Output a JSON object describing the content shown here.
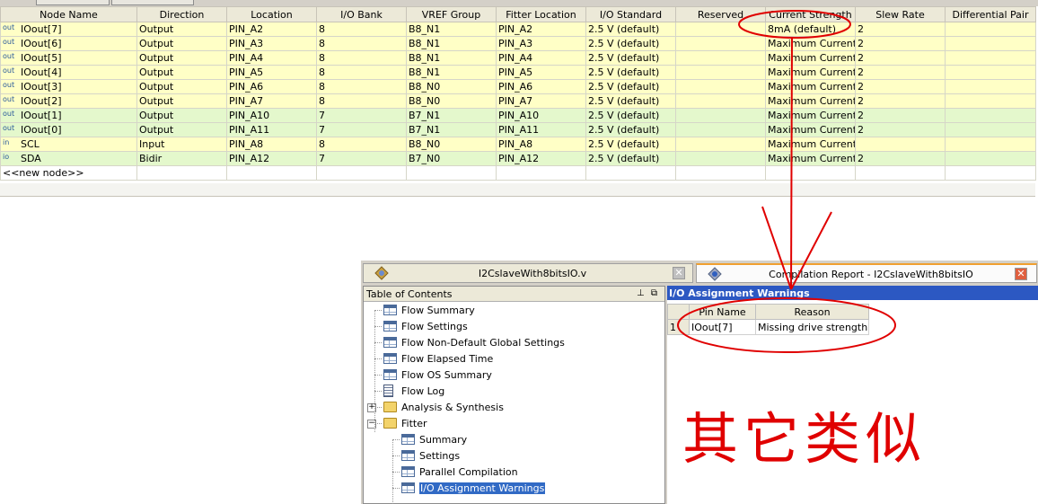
{
  "pin_table": {
    "columns": [
      "Node Name",
      "Direction",
      "Location",
      "I/O Bank",
      "VREF Group",
      "Fitter Location",
      "I/O Standard",
      "Reserved",
      "Current Strength",
      "Slew Rate",
      "Differential Pair"
    ],
    "rows": [
      {
        "icon": "out",
        "name": "IOout[7]",
        "direction": "Output",
        "location": "PIN_A2",
        "bank": "8",
        "vref": "B8_N1",
        "fitter": "PIN_A2",
        "standard": "2.5 V (default)",
        "reserved": "",
        "strength": "8mA (default)",
        "slew": "2",
        "diff": ""
      },
      {
        "icon": "out",
        "name": "IOout[6]",
        "direction": "Output",
        "location": "PIN_A3",
        "bank": "8",
        "vref": "B8_N1",
        "fitter": "PIN_A3",
        "standard": "2.5 V (default)",
        "reserved": "",
        "strength": "Maximum Current",
        "slew": "2",
        "diff": ""
      },
      {
        "icon": "out",
        "name": "IOout[5]",
        "direction": "Output",
        "location": "PIN_A4",
        "bank": "8",
        "vref": "B8_N1",
        "fitter": "PIN_A4",
        "standard": "2.5 V (default)",
        "reserved": "",
        "strength": "Maximum Current",
        "slew": "2",
        "diff": ""
      },
      {
        "icon": "out",
        "name": "IOout[4]",
        "direction": "Output",
        "location": "PIN_A5",
        "bank": "8",
        "vref": "B8_N1",
        "fitter": "PIN_A5",
        "standard": "2.5 V (default)",
        "reserved": "",
        "strength": "Maximum Current",
        "slew": "2",
        "diff": ""
      },
      {
        "icon": "out",
        "name": "IOout[3]",
        "direction": "Output",
        "location": "PIN_A6",
        "bank": "8",
        "vref": "B8_N0",
        "fitter": "PIN_A6",
        "standard": "2.5 V (default)",
        "reserved": "",
        "strength": "Maximum Current",
        "slew": "2",
        "diff": ""
      },
      {
        "icon": "out",
        "name": "IOout[2]",
        "direction": "Output",
        "location": "PIN_A7",
        "bank": "8",
        "vref": "B8_N0",
        "fitter": "PIN_A7",
        "standard": "2.5 V (default)",
        "reserved": "",
        "strength": "Maximum Current",
        "slew": "2",
        "diff": ""
      },
      {
        "icon": "out",
        "name": "IOout[1]",
        "direction": "Output",
        "location": "PIN_A10",
        "bank": "7",
        "vref": "B7_N1",
        "fitter": "PIN_A10",
        "standard": "2.5 V (default)",
        "reserved": "",
        "strength": "Maximum Current",
        "slew": "2",
        "diff": ""
      },
      {
        "icon": "out",
        "name": "IOout[0]",
        "direction": "Output",
        "location": "PIN_A11",
        "bank": "7",
        "vref": "B7_N1",
        "fitter": "PIN_A11",
        "standard": "2.5 V (default)",
        "reserved": "",
        "strength": "Maximum Current",
        "slew": "2",
        "diff": ""
      },
      {
        "icon": "in",
        "name": "SCL",
        "direction": "Input",
        "location": "PIN_A8",
        "bank": "8",
        "vref": "B8_N0",
        "fitter": "PIN_A8",
        "standard": "2.5 V (default)",
        "reserved": "",
        "strength": "Maximum Current",
        "slew": "",
        "diff": ""
      },
      {
        "icon": "io",
        "name": "SDA",
        "direction": "Bidir",
        "location": "PIN_A12",
        "bank": "7",
        "vref": "B7_N0",
        "fitter": "PIN_A12",
        "standard": "2.5 V (default)",
        "reserved": "",
        "strength": "Maximum Current",
        "slew": "2",
        "diff": ""
      }
    ],
    "new_node_label": "<<new node>>"
  },
  "tabs": {
    "file_tab": "I2CslaveWith8bitsIO.v",
    "report_tab": "Compilation Report - I2CslaveWith8bitsIO",
    "close_glyph": "✕"
  },
  "toc": {
    "title": "Table of Contents",
    "pin_buttons": "⊥ ⧉",
    "items": [
      "Flow Summary",
      "Flow Settings",
      "Flow Non-Default Global Settings",
      "Flow Elapsed Time",
      "Flow OS Summary",
      "Flow Log",
      "Analysis & Synthesis",
      "Fitter",
      "Summary",
      "Settings",
      "Parallel Compilation",
      "I/O Assignment Warnings"
    ],
    "expand_plus": "+",
    "expand_minus": "−"
  },
  "report": {
    "title": "I/O Assignment Warnings",
    "columns": [
      "Pin Name",
      "Reason"
    ],
    "rows": [
      {
        "num": "1",
        "pin": "IOout[7]",
        "reason": "Missing drive strength"
      }
    ]
  },
  "annotation": {
    "text": "其它类似",
    "color": "#e00000"
  },
  "icons": {
    "out": "out",
    "in": "in",
    "io": "io"
  }
}
